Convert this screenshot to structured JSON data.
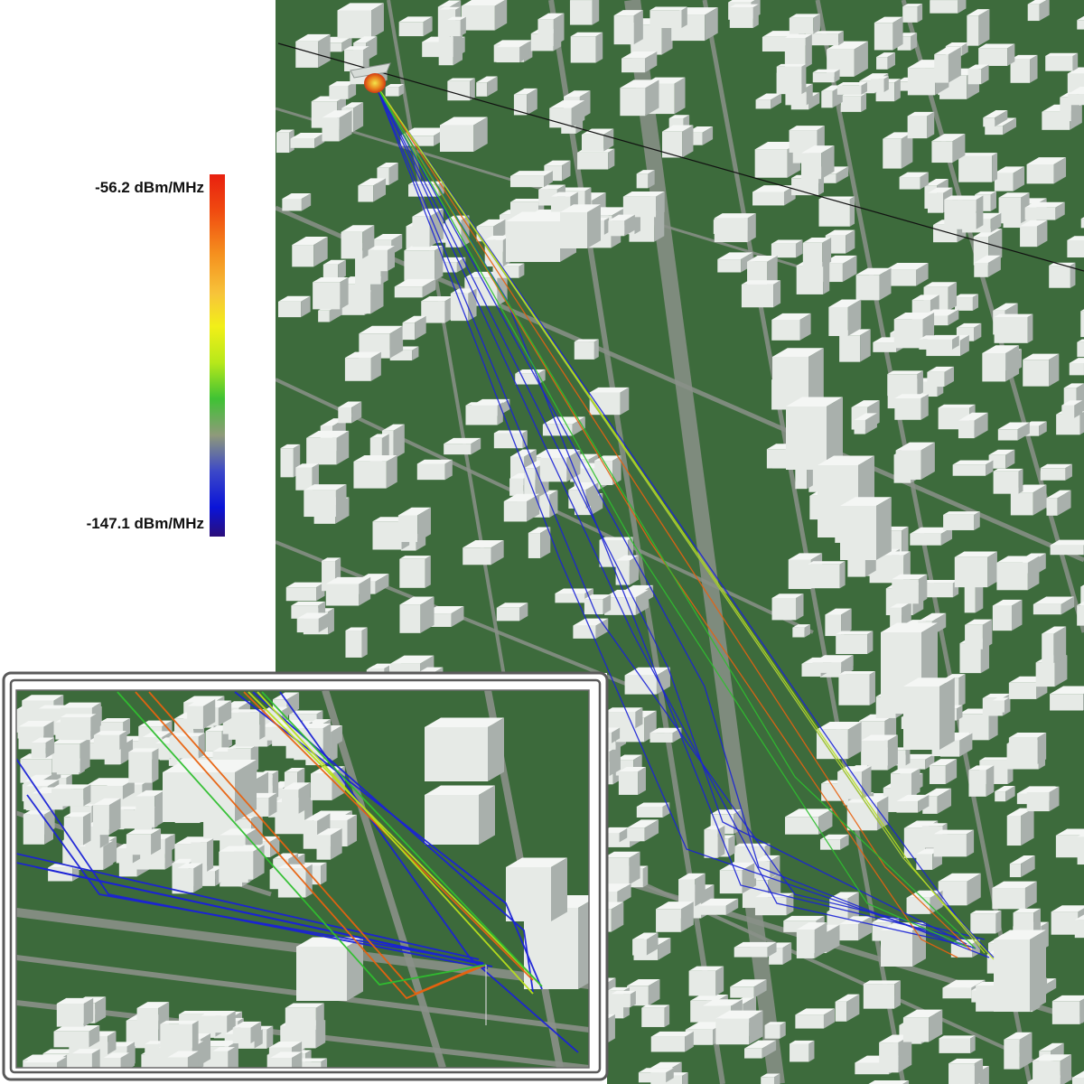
{
  "legend": {
    "max_label": "-56.2 dBm/MHz",
    "min_label": "-147.1 dBm/MHz"
  },
  "colors": {
    "ground": "#3c6a3b",
    "road": "#8a9088",
    "building": "#e6eae6",
    "building_shade": "#a9b0ac",
    "ray_strong": "#e8620f",
    "ray_mid": "#b8e01c",
    "ray_green": "#2fbf2f",
    "ray_weak": "#1a22d6",
    "inset_frame": "#5a5a5a"
  }
}
